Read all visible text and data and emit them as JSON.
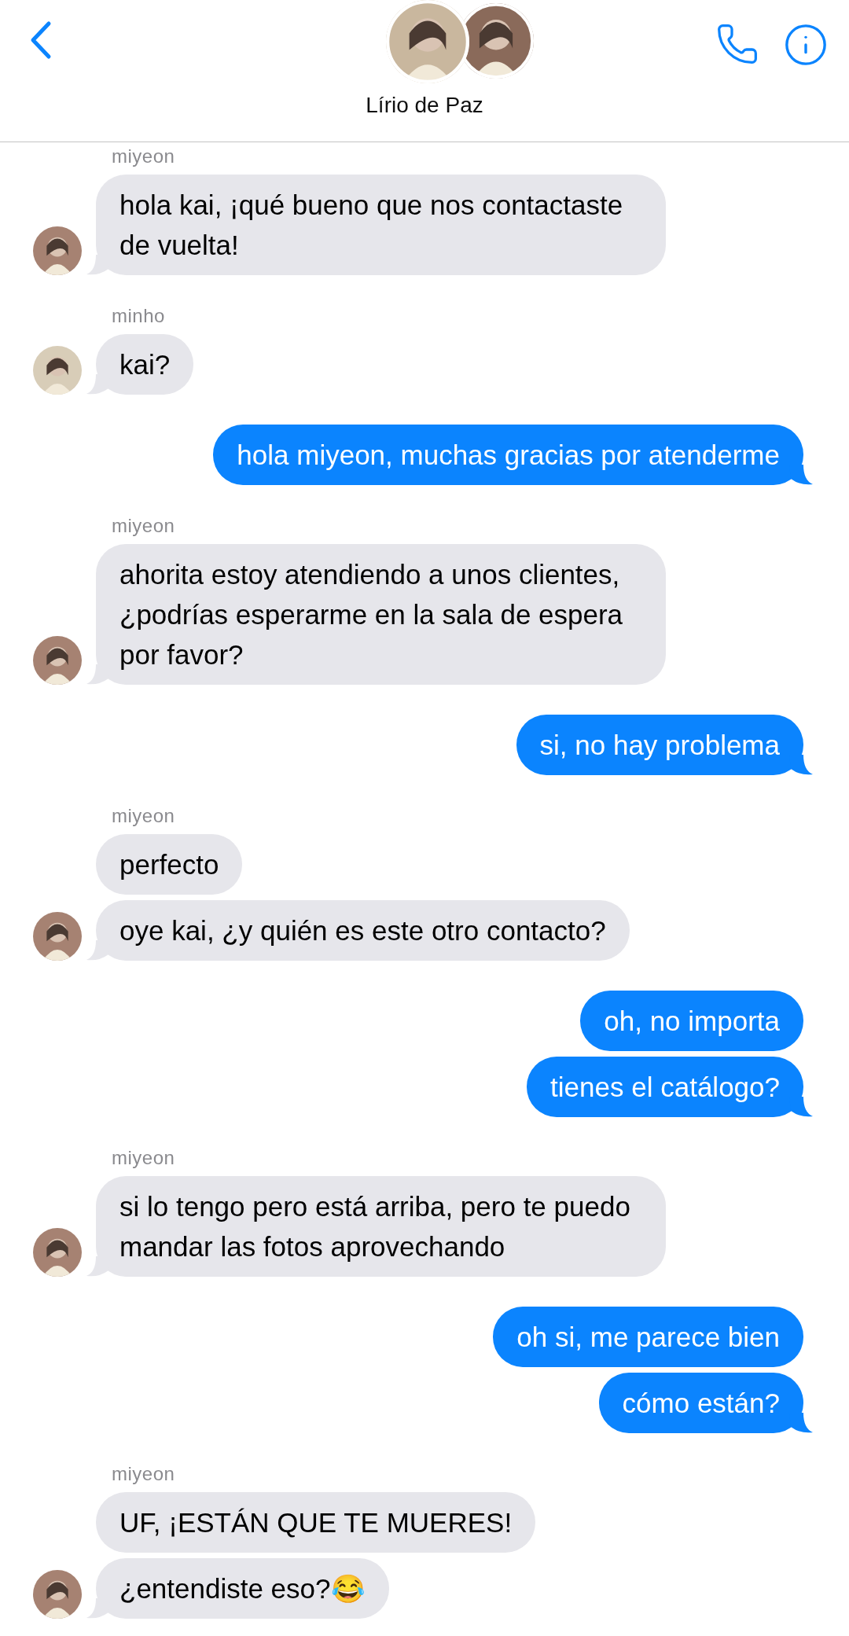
{
  "header": {
    "title": "Lírio de Paz"
  },
  "groups": [
    {
      "kind": "incoming",
      "sender": "miyeon",
      "messages": [
        "hola kai, ¡qué bueno que nos contactaste de vuelta!"
      ]
    },
    {
      "kind": "incoming",
      "sender": "minho",
      "messages": [
        "kai?"
      ]
    },
    {
      "kind": "outgoing",
      "messages": [
        "hola miyeon, muchas gracias por atenderme"
      ]
    },
    {
      "kind": "incoming",
      "sender": "miyeon",
      "messages": [
        "ahorita estoy atendiendo a unos clientes, ¿podrías esperarme en la sala de espera por favor?"
      ]
    },
    {
      "kind": "outgoing",
      "messages": [
        "si, no hay problema"
      ]
    },
    {
      "kind": "incoming",
      "sender": "miyeon",
      "messages": [
        "perfecto",
        "oye kai, ¿y quién es este otro contacto?"
      ]
    },
    {
      "kind": "outgoing",
      "messages": [
        "oh, no importa",
        "tienes el catálogo?"
      ]
    },
    {
      "kind": "incoming",
      "sender": "miyeon",
      "messages": [
        "si lo tengo pero está arriba, pero te puedo mandar las fotos aprovechando"
      ]
    },
    {
      "kind": "outgoing",
      "messages": [
        "oh si, me parece bien",
        "cómo están?"
      ]
    },
    {
      "kind": "incoming",
      "sender": "miyeon",
      "messages": [
        "UF, ¡ESTÁN QUE TE MUERES!",
        "¿entendiste eso?😂"
      ]
    }
  ]
}
